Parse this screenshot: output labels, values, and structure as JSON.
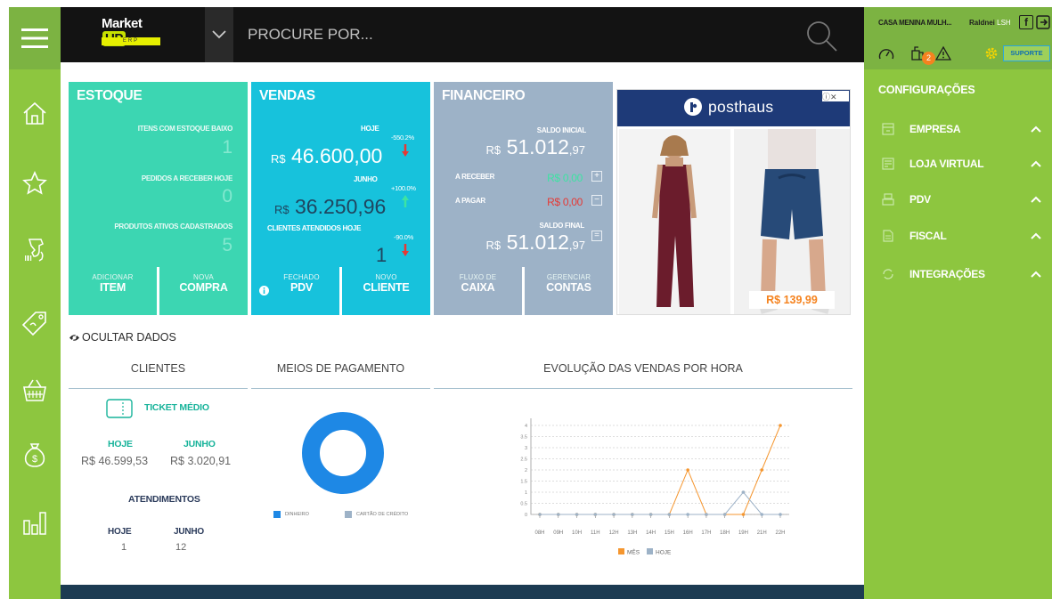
{
  "topbar": {
    "logo": "MarketUP",
    "logo_word": "Market",
    "logo_up": "UP",
    "logo_sub": "ERP",
    "search_placeholder": "PROCURE POR..."
  },
  "account": {
    "store": "CASA MENINA MULH...",
    "user": "Raldnei",
    "user_suffix": "LSH",
    "facebook": "f",
    "notification_count": "2",
    "support_label": "SUPORTE"
  },
  "config": {
    "title": "CONFIGURAÇÕES",
    "items": [
      {
        "label": "EMPRESA",
        "icon": "building-icon"
      },
      {
        "label": "LOJA VIRTUAL",
        "icon": "store-icon"
      },
      {
        "label": "PDV",
        "icon": "register-icon"
      },
      {
        "label": "FISCAL",
        "icon": "document-icon"
      },
      {
        "label": "INTEGRAÇÕES",
        "icon": "sync-icon"
      }
    ]
  },
  "sidebar": {
    "items": [
      "home-icon",
      "star-icon",
      "scanner-icon",
      "tag-icon",
      "basket-icon",
      "money-bag-icon",
      "bar-chart-icon"
    ]
  },
  "estoque": {
    "title": "ESTOQUE",
    "low_stock_label": "ITENS COM ESTOQUE BAIXO",
    "low_stock_value": "1",
    "orders_label": "PEDIDOS A RECEBER HOJE",
    "orders_value": "0",
    "active_label": "PRODUTOS ATIVOS CADASTRADOS",
    "active_value": "5",
    "btn1_small": "ADICIONAR",
    "btn1_big": "ITEM",
    "btn2_small": "NOVA",
    "btn2_big": "COMPRA"
  },
  "vendas": {
    "title": "VENDAS",
    "today_label": "HOJE",
    "today_pct": "-550.2%",
    "currency": "R$",
    "today_value": "46.600,00",
    "month_label": "JUNHO",
    "month_pct": "+100.0%",
    "month_value": "36.250,96",
    "clients_label": "CLIENTES ATENDIDOS HOJE",
    "clients_pct": "-90.0%",
    "clients_value": "1",
    "btn1_small": "FECHADO",
    "btn1_big": "PDV",
    "btn2_small": "NOVO",
    "btn2_big": "CLIENTE"
  },
  "financeiro": {
    "title": "FINANCEIRO",
    "initial_label": "SALDO INICIAL",
    "currency": "R$",
    "initial_int": "51.012",
    "initial_dec": ",97",
    "receive_label": "A RECEBER",
    "receive_value": "R$ 0,00",
    "pay_label": "A PAGAR",
    "pay_value": "R$ 0,00",
    "final_label": "SALDO FINAL",
    "final_int": "51.012",
    "final_dec": ",97",
    "plus": "+",
    "minus": "−",
    "equals": "=",
    "btn1_small": "FLUXO DE",
    "btn1_big": "CAIXA",
    "btn2_small": "GERENCIAR",
    "btn2_big": "CONTAS"
  },
  "ad": {
    "brand": "posthaus",
    "price": "R$ 139,99",
    "close": "ⓘ✕"
  },
  "hide_data_label": "OCULTAR DADOS",
  "clients": {
    "title": "CLIENTES",
    "ticket_label": "TICKET MÉDIO",
    "today_label": "HOJE",
    "month_label": "JUNHO",
    "ticket_today": "R$ 46.599,53",
    "ticket_month": "R$ 3.020,91",
    "attend_title": "ATENDIMENTOS",
    "attend_today_label": "HOJE",
    "attend_month_label": "JUNHO",
    "attend_today": "1",
    "attend_month": "12"
  },
  "payments": {
    "title": "MEIOS DE PAGAMENTO",
    "legend": [
      "DINHEIRO",
      "CARTÃO DE CRÉDITO"
    ]
  },
  "sales_hour": {
    "title": "EVOLUÇÃO DAS VENDAS POR HORA"
  },
  "chart_data": [
    {
      "type": "pie",
      "labels": [
        "DINHEIRO",
        "CARTÃO DE CRÉDITO"
      ],
      "values": [
        100,
        0
      ],
      "colors": [
        "#1e88e5",
        "#9db2c7"
      ],
      "legend": "bottom"
    },
    {
      "type": "line",
      "title": "EVOLUÇÃO DAS VENDAS POR HORA",
      "categories": [
        "08H",
        "09H",
        "10H",
        "11H",
        "12H",
        "13H",
        "14H",
        "15H",
        "16H",
        "17H",
        "18H",
        "19H",
        "21H",
        "22H"
      ],
      "series": [
        {
          "name": "MÊS",
          "color": "#f5962f",
          "values": [
            0,
            0,
            0,
            0,
            0,
            0,
            0,
            0,
            2,
            0,
            0,
            0,
            2,
            4
          ]
        },
        {
          "name": "HOJE",
          "color": "#9db2c7",
          "values": [
            0,
            0,
            0,
            0,
            0,
            0,
            0,
            0,
            0,
            0,
            0,
            1,
            0,
            0
          ]
        }
      ],
      "yticks": [
        "0",
        "0.5",
        "1",
        "1.5",
        "2",
        "2.5",
        "3",
        "3.5",
        "4"
      ],
      "ylim": [
        0,
        4
      ],
      "grid": true,
      "legend": "bottom"
    }
  ]
}
